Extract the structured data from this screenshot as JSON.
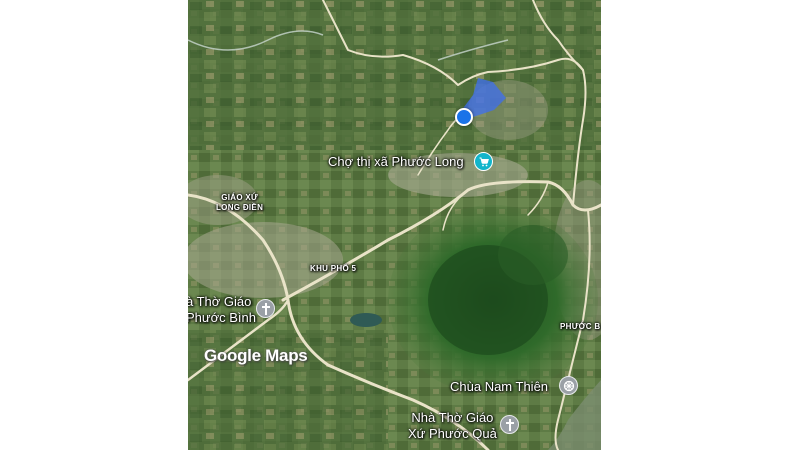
{
  "map": {
    "watermark": "Google Maps",
    "poi": {
      "market": "Chợ thị xã Phước Long",
      "church1_line1": "à Thờ Giáo",
      "church1_line2": "Phước Bình",
      "temple": "Chùa Nam Thiên",
      "church2_line1": "Nhà Thờ Giáo",
      "church2_line2": "Xứ Phước Quả"
    },
    "areas": {
      "giao_xu_1": "GIÁO XỨ",
      "giao_xu_2": "LONG ĐIỀN",
      "khu_pho": "KHU PHỐ 5",
      "phuoc": "PHƯỚC B"
    },
    "icons": {
      "market": "shopping-cart-icon",
      "church": "cross-icon",
      "temple": "dharma-wheel-icon"
    },
    "colors": {
      "location": "#1a73e8",
      "shop_pin": "#12b5cb",
      "place_pin": "#9aa0a6"
    }
  }
}
